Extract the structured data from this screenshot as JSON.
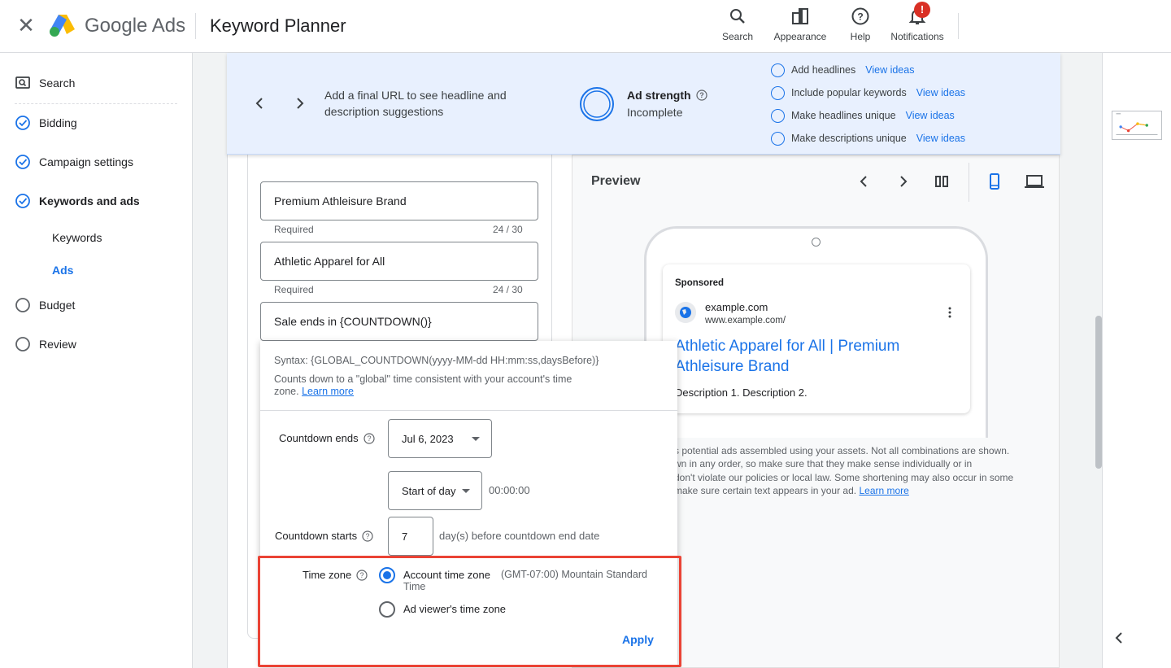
{
  "header": {
    "brand_google": "Google",
    "brand_ads": "Ads",
    "title": "Keyword Planner",
    "tools": [
      {
        "label": "Search",
        "icon": "search-icon"
      },
      {
        "label": "Appearance",
        "icon": "appearance-icon"
      },
      {
        "label": "Help",
        "icon": "help-icon"
      },
      {
        "label": "Notifications",
        "icon": "bell-icon",
        "badge": "!"
      }
    ]
  },
  "sidebar": {
    "items": [
      {
        "label": "Search",
        "icon": "search-box-icon"
      },
      {
        "label": "Bidding",
        "icon": "check-circle-icon"
      },
      {
        "label": "Campaign settings",
        "icon": "check-circle-icon"
      },
      {
        "label": "Keywords and ads",
        "icon": "check-circle-icon"
      },
      {
        "label": "Budget",
        "icon": "empty-circle-icon"
      },
      {
        "label": "Review",
        "icon": "empty-circle-icon"
      }
    ],
    "subitems": [
      {
        "label": "Keywords"
      },
      {
        "label": "Ads",
        "active": true
      }
    ]
  },
  "banner": {
    "message": "Add a final URL to see headline and description suggestions",
    "strength_title": "Ad strength",
    "strength_value": "Incomplete",
    "tips": [
      {
        "label": "Add headlines",
        "action": "View ideas"
      },
      {
        "label": "Include popular keywords",
        "action": "View ideas"
      },
      {
        "label": "Make headlines unique",
        "action": "View ideas"
      },
      {
        "label": "Make descriptions unique",
        "action": "View ideas"
      }
    ]
  },
  "headlines": [
    {
      "value": "Premium Athleisure Brand",
      "helper": "Required",
      "counter": "24 / 30"
    },
    {
      "value": "Athletic Apparel for All",
      "helper": "Required",
      "counter": "24 / 30"
    },
    {
      "value": "Sale ends in {COUNTDOWN()}"
    }
  ],
  "popup": {
    "syntax": "Syntax: {GLOBAL_COUNTDOWN(yyyy-MM-dd HH:mm:ss,daysBefore)}",
    "desc_line1": "Counts down to a \"global\" time consistent with your account's time",
    "desc_line2": "zone.",
    "learn_more": "Learn more",
    "countdown_ends_label": "Countdown ends",
    "date_value": "Jul 6, 2023",
    "time_select": "Start of day",
    "time_value": "00:00:00",
    "countdown_starts_label": "Countdown starts",
    "days_value": "7",
    "days_suffix": "day(s) before countdown end date",
    "timezone_label": "Time zone",
    "tz_account": "Account time zone",
    "tz_account_detail_1": "(GMT-07:00) Mountain Standard",
    "tz_account_detail_2": "Time",
    "tz_viewer": "Ad viewer's time zone",
    "tz_selected": "account",
    "apply": "Apply"
  },
  "preview": {
    "title": "Preview",
    "sponsored": "Sponsored",
    "domain": "example.com",
    "display_url": "www.example.com/",
    "headline_line1": "Athletic Apparel for All | Premium",
    "headline_line2": "Athleisure Brand",
    "description": "Description 1. Description 2.",
    "disclaimer_1": "s potential ads assembled using your assets. Not all combinations are shown.",
    "disclaimer_2": "wn in any order, so make sure that they make sense individually or in",
    "disclaimer_3": "don't violate our policies or local law. Some shortening may also occur in some",
    "disclaimer_4": "make sure certain text appears in your ad.",
    "learn_more": "Learn more"
  },
  "colors": {
    "accent": "#1a73e8",
    "banner_bg": "#e8f0fe",
    "highlight": "#ea4335",
    "badge": "#d93025"
  }
}
